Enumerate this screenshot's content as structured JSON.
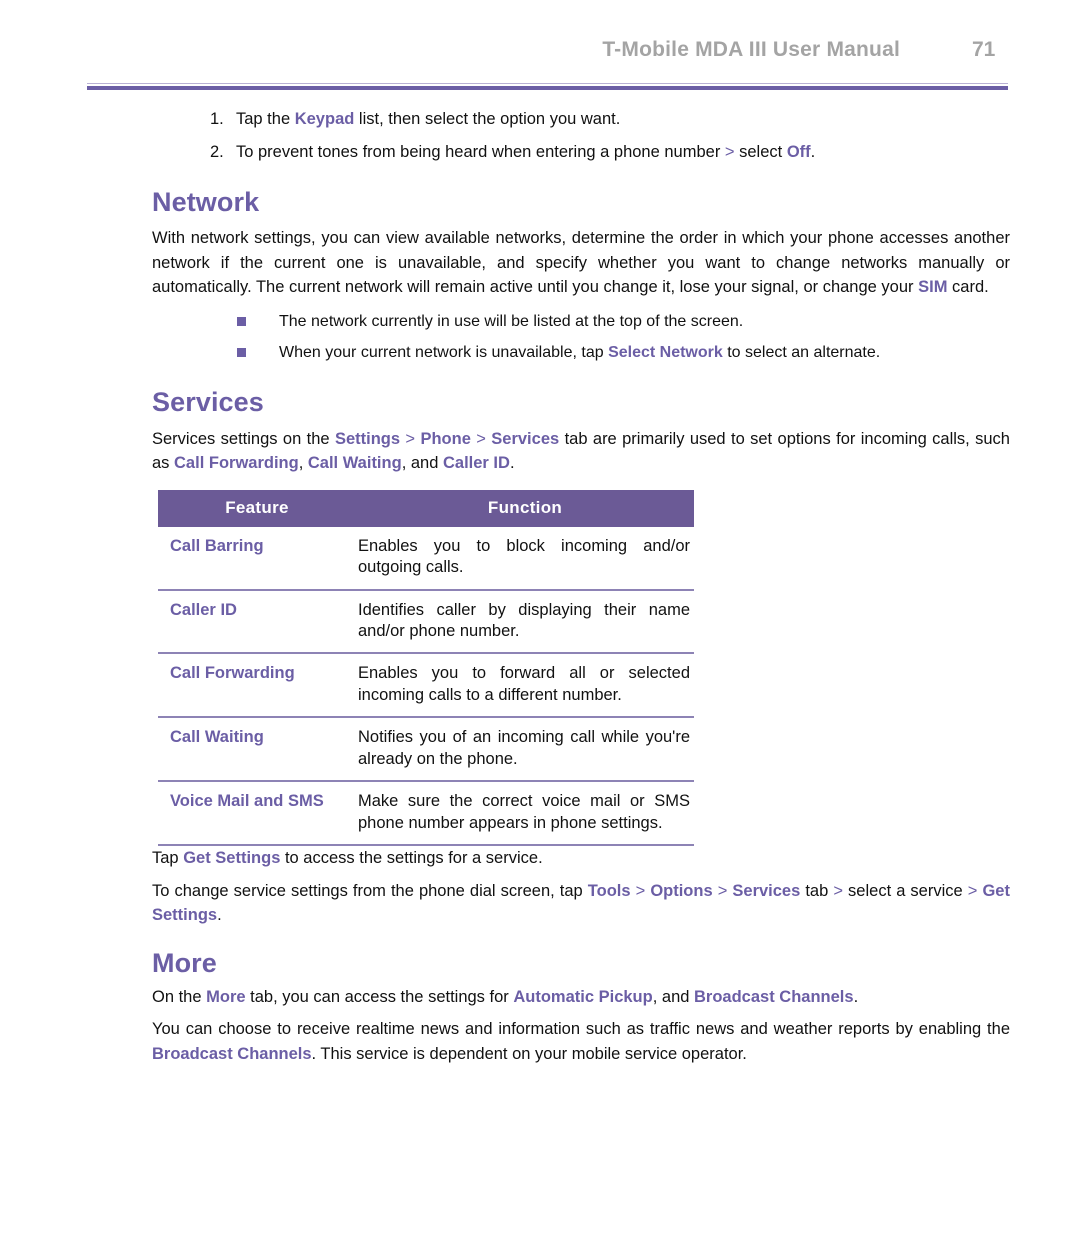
{
  "header": {
    "title": "T-Mobile MDA III User Manual",
    "page_number": "71"
  },
  "steps": [
    {
      "marker": "1.",
      "pre": "Tap the ",
      "hl1": "Keypad",
      "post": " list, then select the option you want."
    },
    {
      "marker": "2.",
      "pre": "To prevent tones from being heard when entering a phone number ",
      "sep": ">",
      "mid": " select ",
      "hl1": "Off",
      "post": "."
    }
  ],
  "network": {
    "heading": "Network",
    "paragraph_pre": "With network settings, you can view available networks, determine the order in which your phone accesses another network if the current one is unavailable, and specify whether you want to change networks manually or automatically. The current network will remain active until you change it, lose your signal, or change your ",
    "paragraph_hl": "SIM",
    "paragraph_post": " card.",
    "bullets": [
      {
        "pre": "The network currently in use will be listed at the top of the screen.",
        "hl": "",
        "post": ""
      },
      {
        "pre": "When your current network is unavailable, tap ",
        "hl": "Select Network",
        "post": " to select an alternate."
      }
    ]
  },
  "services": {
    "heading": "Services",
    "intro_1": "Services settings on the ",
    "intro_settings": "Settings",
    "intro_gt1": " > ",
    "intro_phone": "Phone",
    "intro_gt2": " > ",
    "intro_services": "Services",
    "intro_2": " tab are primarily used to set options for incoming calls, such as ",
    "intro_cf": "Call Forwarding",
    "intro_comma1": ", ",
    "intro_cw": "Call Waiting",
    "intro_and": ", and ",
    "intro_cid": "Caller ID",
    "intro_end": ".",
    "table": {
      "columns": [
        "Feature",
        "Function"
      ],
      "rows": [
        {
          "feature": "Call Barring",
          "function": "Enables you to block incoming and/or outgoing calls."
        },
        {
          "feature": "Caller ID",
          "function": "Identifies caller by displaying their name and/or phone number."
        },
        {
          "feature": "Call Forwarding",
          "function": "Enables you to forward all or selected incoming calls to a different number."
        },
        {
          "feature": "Call Waiting",
          "function": "Notifies you of an incoming call while you're already on the phone."
        },
        {
          "feature": "Voice Mail and SMS",
          "function": "Make sure the correct voice mail or SMS phone number appears in phone settings."
        }
      ]
    },
    "tap_pre": "Tap ",
    "tap_hl": "Get Settings",
    "tap_post": " to access the settings for a service.",
    "change_pre": "To change service settings from the phone dial screen, tap ",
    "change_tools": "Tools",
    "change_gt1": " > ",
    "change_options": "Options",
    "change_gt2": " > ",
    "change_services": "Services",
    "change_mid": " tab ",
    "change_gt3": "> ",
    "change_selecta": "select a service ",
    "change_gt4": "> ",
    "change_getsettings": "Get Settings",
    "change_end": "."
  },
  "more": {
    "heading": "More",
    "p1_pre": "On the ",
    "p1_more": "More",
    "p1_mid": " tab, you can access the settings for ",
    "p1_autopickup": "Automatic Pickup",
    "p1_and": ", and ",
    "p1_broadcast": "Broadcast Channels",
    "p1_end": ".",
    "p2_pre": "You can choose to receive realtime news and information such as traffic news and weather reports by enabling the ",
    "p2_hl": "Broadcast Channels",
    "p2_post": ". This service is dependent on your mobile service operator."
  },
  "colors": {
    "accent_purple": "#6b5ea5",
    "table_header_bg": "#6b5a96",
    "header_gray": "#a4a4a4",
    "row_divider": "#8d83b5"
  }
}
